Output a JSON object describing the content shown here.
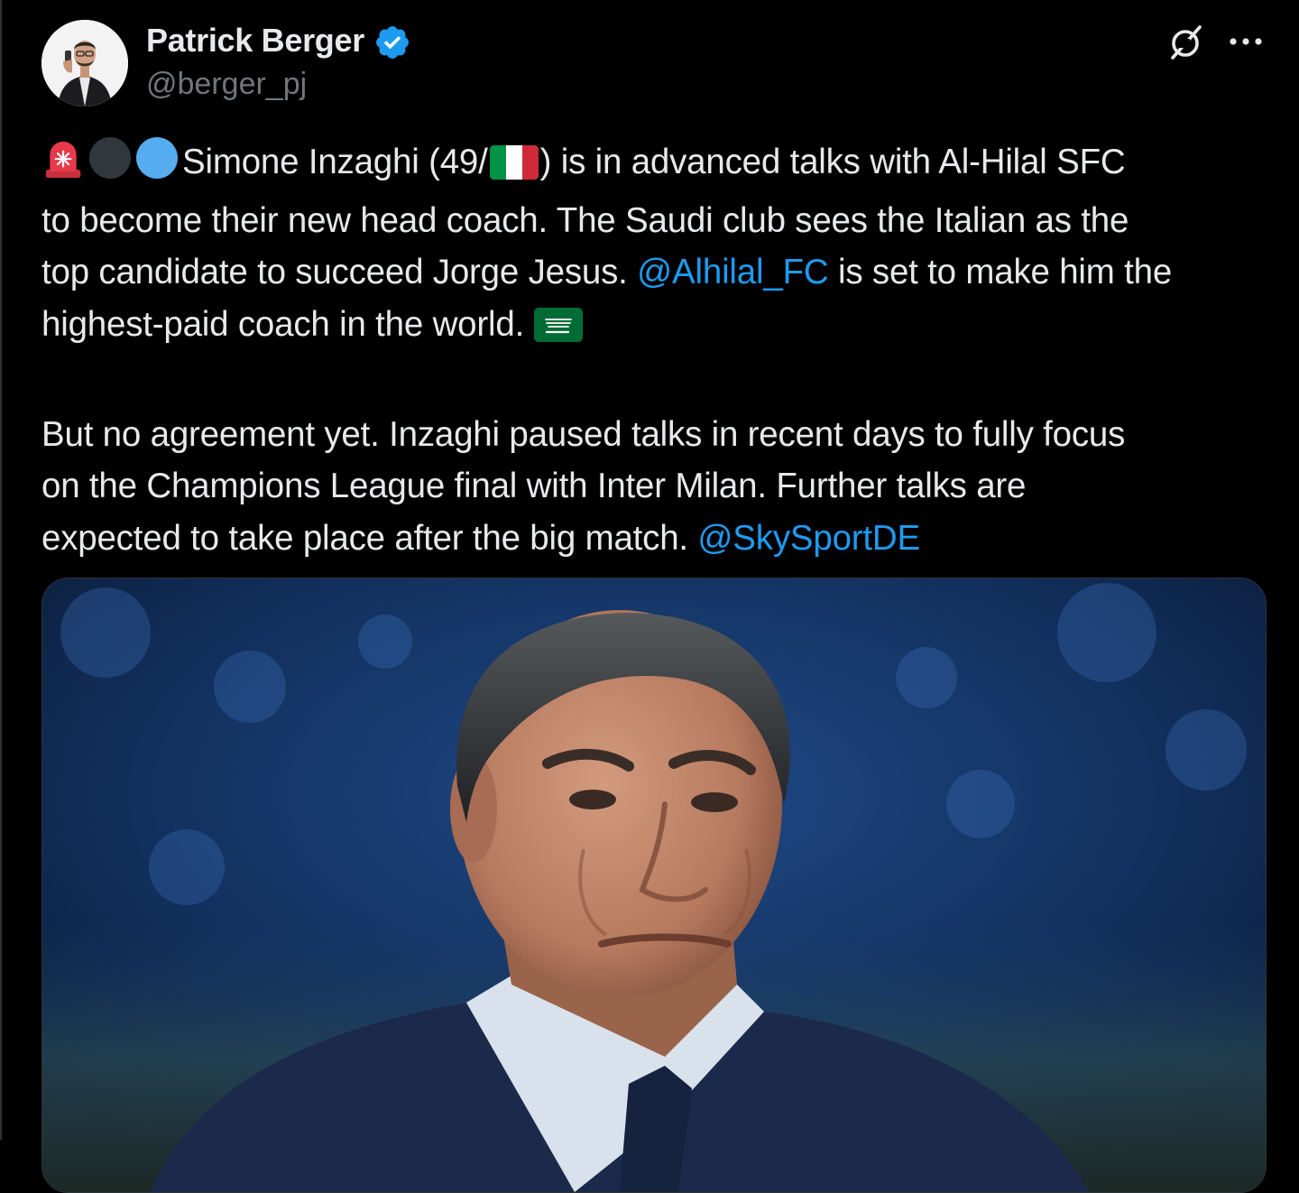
{
  "author": {
    "name": "Patrick Berger",
    "handle": "@berger_pj",
    "verified": true,
    "verified_color": "#1d9bf0"
  },
  "actions": {
    "grok_icon": "grok-slash-icon",
    "more_icon": "more-dots-icon"
  },
  "tweet": {
    "lead_emojis": [
      "rotating-light-emoji",
      "black-circle-emoji",
      "blue-circle-emoji"
    ],
    "p1": {
      "l1_a": "Simone Inzaghi (49/",
      "l1_flag": "italy-flag-emoji",
      "l1_b": ") is in advanced talks with Al-Hilal SFC",
      "l2": "to become their new head coach. The Saudi club sees the Italian as the",
      "l3_a": "top candidate to succeed Jorge Jesus. ",
      "l3_mention": "@Alhilal_FC",
      "l3_b": " is set to make him the",
      "l4": "highest-paid coach in the world. ",
      "l4_flag": "saudi-flag-emoji"
    },
    "p2": {
      "l1": "But no agreement yet. Inzaghi paused talks in recent days to fully focus",
      "l2": "on the Champions League final with Inter Milan. Further talks are",
      "l3": "expected to take place after the big match. ",
      "l3_mention": "@SkySportDE"
    }
  },
  "media": {
    "kind": "photo",
    "subject": "coach-portrait-photo"
  },
  "colors": {
    "background": "#000000",
    "text": "#e7e9ea",
    "secondary": "#71767b",
    "link": "#1d9bf0",
    "border": "#2f3336"
  }
}
